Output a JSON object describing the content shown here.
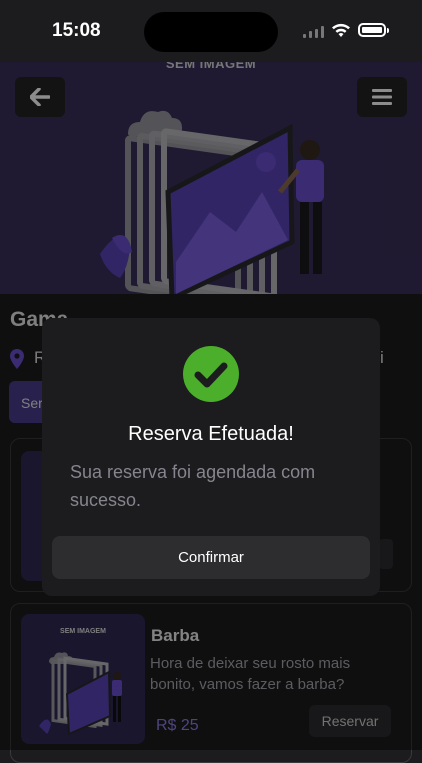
{
  "status_bar": {
    "time": "15:08"
  },
  "hero": {
    "image_text": "SEM IMAGEM"
  },
  "header": {
    "back_icon": "arrow-left-icon",
    "menu_icon": "hamburger-menu-icon"
  },
  "page": {
    "title": "Gama",
    "location_prefix": "R",
    "location_suffix": "i",
    "service_chip": "Ser"
  },
  "services": [
    {
      "image_text": "SEM IMAGEM",
      "title": "Barba",
      "description": "Hora de deixar seu rosto mais bonito, vamos fazer a barba?",
      "price": "R$ 25",
      "button": "Reservar"
    }
  ],
  "modal": {
    "title": "Reserva Efetuada!",
    "message": "Sua reserva foi agendada com sucesso.",
    "confirm_label": "Confirmar",
    "icon": "check-circle-icon"
  },
  "colors": {
    "accent": "#6a4fcf",
    "success": "#4caf2b",
    "background": "#1c1c1e"
  }
}
